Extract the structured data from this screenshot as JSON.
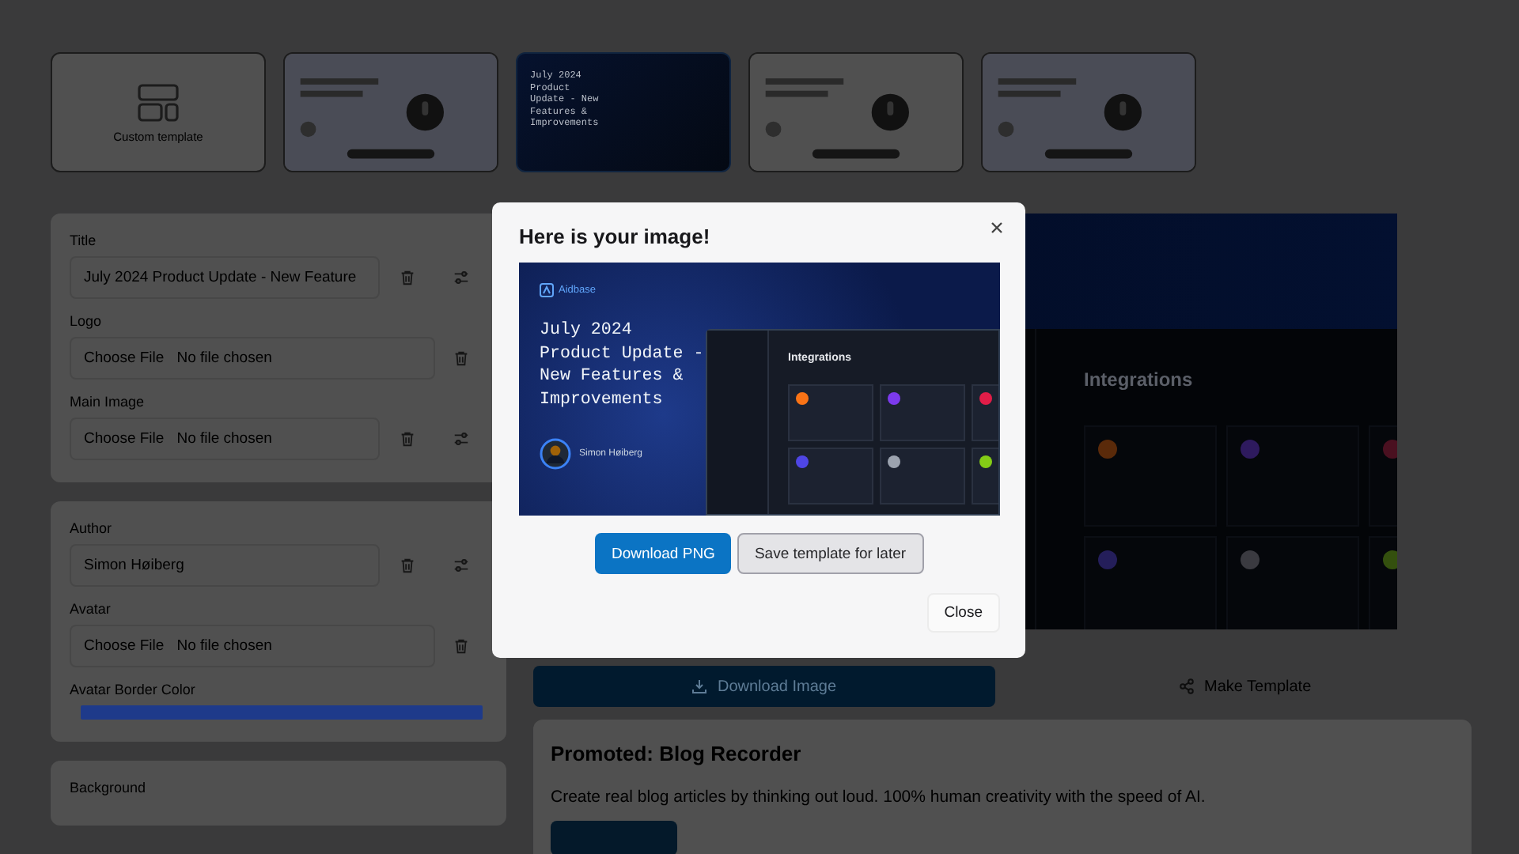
{
  "templates": [
    {
      "kind": "custom",
      "label": "Custom template",
      "selected": false
    },
    {
      "kind": "picture",
      "selected": false
    },
    {
      "kind": "product-update",
      "title": "July 2024 Product Update - New Features & Improvements",
      "selected": true
    },
    {
      "kind": "picture",
      "selected": false
    },
    {
      "kind": "picture",
      "selected": false
    }
  ],
  "form": {
    "sections": [
      {
        "fields": [
          {
            "kind": "text",
            "label": "Title",
            "value": "July 2024 Product Update - New Feature",
            "adjustable": true
          },
          {
            "kind": "file",
            "label": "Logo",
            "button": "Choose File",
            "status": "No file chosen",
            "adjustable": false
          },
          {
            "kind": "file",
            "label": "Main Image",
            "button": "Choose File",
            "status": "No file chosen",
            "adjustable": true
          }
        ]
      },
      {
        "fields": [
          {
            "kind": "text",
            "label": "Author",
            "value": "Simon Høiberg",
            "adjustable": true
          },
          {
            "kind": "file",
            "label": "Avatar",
            "button": "Choose File",
            "status": "No file chosen",
            "adjustable": false
          },
          {
            "kind": "color",
            "label": "Avatar Border Color",
            "color": "#1e3a8a"
          }
        ]
      },
      {
        "fields": [
          {
            "kind": "heading",
            "label": "Background"
          }
        ]
      }
    ]
  },
  "preview": {
    "screen_title": "Integrations"
  },
  "actions": {
    "download": "Download Image",
    "template": "Make Template"
  },
  "promo": {
    "title": "Promoted: Blog Recorder",
    "text": "Create real blog articles by thinking out loud. 100% human creativity with the speed of AI."
  },
  "dialog": {
    "title": "Here is your image!",
    "image": {
      "logo": "Aidbase",
      "headline": "July 2024 Product Update - New Features & Improvements",
      "author": "Simon Høiberg",
      "screen_title": "Integrations"
    },
    "buttons": [
      {
        "kind": "primary",
        "label": "Download PNG"
      },
      {
        "kind": "secondary",
        "label": "Save template for later"
      }
    ],
    "close": "Close"
  }
}
